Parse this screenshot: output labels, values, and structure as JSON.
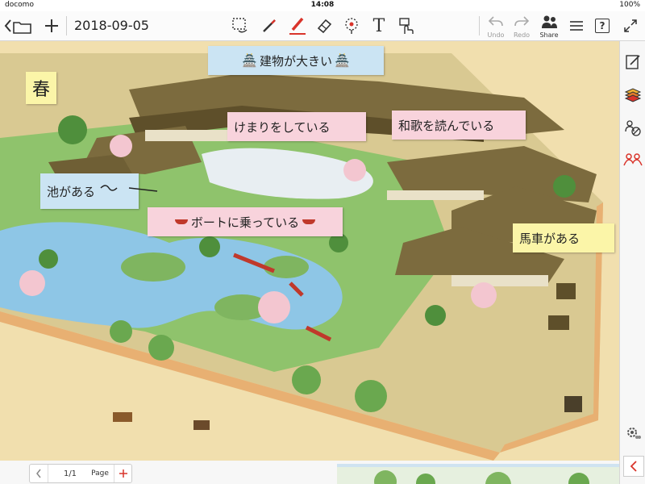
{
  "status_bar": {
    "carrier": "docomo",
    "time": "14:08",
    "battery": "100%"
  },
  "toolbar": {
    "doc_title": "2018-09-05",
    "undo_label": "Undo",
    "redo_label": "Redo",
    "share_label": "Share",
    "text_tool_icon": "T",
    "help_icon": "?"
  },
  "notes": {
    "season": "春",
    "building": "建物が大きい",
    "kemari": "けまりをしている",
    "waka": "和歌を読んでいる",
    "pond": "池がある",
    "boat": "ボートに乗っている",
    "carriage": "馬車がある"
  },
  "pager": {
    "page": "1/1",
    "page_label": "Page"
  },
  "colors": {
    "accent": "#d9342b",
    "pink_note": "#f8d3dc",
    "blue_note": "#cbe4f3",
    "yellow_note": "#fbf5a8",
    "grass": "#7fb560",
    "water": "#8ec6e6",
    "roof": "#7c6b3e"
  }
}
